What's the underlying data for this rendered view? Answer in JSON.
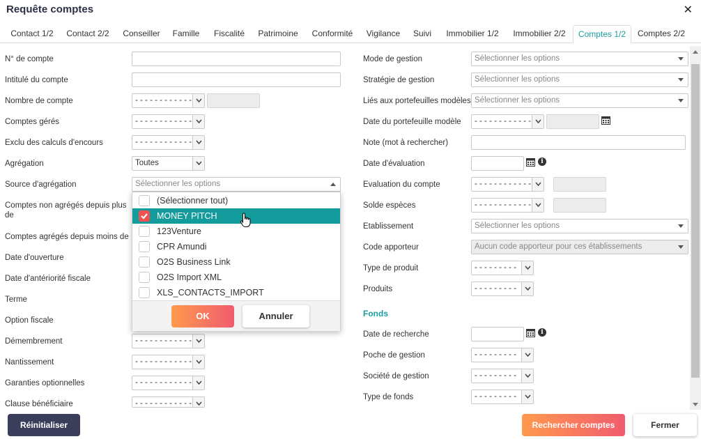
{
  "window": {
    "title": "Requête comptes",
    "close_glyph": "✕"
  },
  "tabs": [
    {
      "label": "Contact 1/2"
    },
    {
      "label": "Contact 2/2"
    },
    {
      "label": "Conseiller"
    },
    {
      "label": "Famille"
    },
    {
      "label": "Fiscalité"
    },
    {
      "label": "Patrimoine"
    },
    {
      "label": "Conformité"
    },
    {
      "label": "Vigilance"
    },
    {
      "label": "Suivi"
    },
    {
      "label": "Immobilier 1/2"
    },
    {
      "label": "Immobilier 2/2"
    },
    {
      "label": "Comptes 1/2"
    },
    {
      "label": "Comptes 2/2"
    }
  ],
  "active_tab": "Comptes 1/2",
  "left": {
    "num_compte": "N° de compte",
    "intitule": "Intitulé du compte",
    "nombre": "Nombre de compte",
    "geres": "Comptes gérés",
    "exclu": "Exclu des calculs d'encours",
    "agregation": "Agrégation",
    "agregation_value": "Toutes",
    "source": "Source d'agrégation",
    "source_placeholder": "Sélectionner les options",
    "non_agreges": "Comptes non agrégés depuis plus de",
    "agreges_moins": "Comptes agrégés depuis moins de",
    "ouverture": "Date d'ouverture",
    "anteriorite": "Date d'antériorité fiscale",
    "terme": "Terme",
    "option_fiscale": "Option fiscale",
    "demembrement": "Démembrement",
    "nantissement": "Nantissement",
    "garanties": "Garanties optionnelles",
    "clause": "Clause bénéficiaire",
    "dash_long": "- - - - - - - - - - - - - - -"
  },
  "dropdown": {
    "options": [
      {
        "label": "(Sélectionner tout)",
        "checked": false
      },
      {
        "label": "MONEY PITCH",
        "checked": true
      },
      {
        "label": "123Venture",
        "checked": false
      },
      {
        "label": "CPR Amundi",
        "checked": false
      },
      {
        "label": "O2S Business Link",
        "checked": false
      },
      {
        "label": "O2S Import XML",
        "checked": false
      },
      {
        "label": "XLS_CONTACTS_IMPORT",
        "checked": false
      }
    ],
    "ok_label": "OK",
    "cancel_label": "Annuler"
  },
  "right": {
    "mode_gestion": "Mode de gestion",
    "strategie": "Stratégie de gestion",
    "lies": "Liés aux portefeuilles modèles",
    "date_portefeuille": "Date du portefeuille modèle",
    "note": "Note (mot à rechercher)",
    "date_evaluation": "Date d'évaluation",
    "evaluation_compte": "Evaluation du compte",
    "solde": "Solde espèces",
    "etablissement": "Etablissement",
    "code_apporteur": "Code apporteur",
    "code_apporteur_placeholder": "Aucun code apporteur pour ces établissements",
    "type_produit": "Type de produit",
    "produits": "Produits",
    "fonds_title": "Fonds",
    "date_recherche": "Date de recherche",
    "poche": "Poche de gestion",
    "societe": "Société de gestion",
    "type_fonds": "Type de fonds",
    "select_placeholder": "Sélectionner les options",
    "dash_long": "- - - - - - - - - - - - - - -",
    "dash_short": "- - - - - - - - -"
  },
  "footer": {
    "reset_label": "Réinitialiser",
    "search_label": "Rechercher comptes",
    "close_label": "Fermer"
  },
  "colors": {
    "accent": "#1a9da0",
    "selected_row": "#149c9c",
    "checkbox_on": "#f05050",
    "dark_button": "#3b3e5a"
  }
}
